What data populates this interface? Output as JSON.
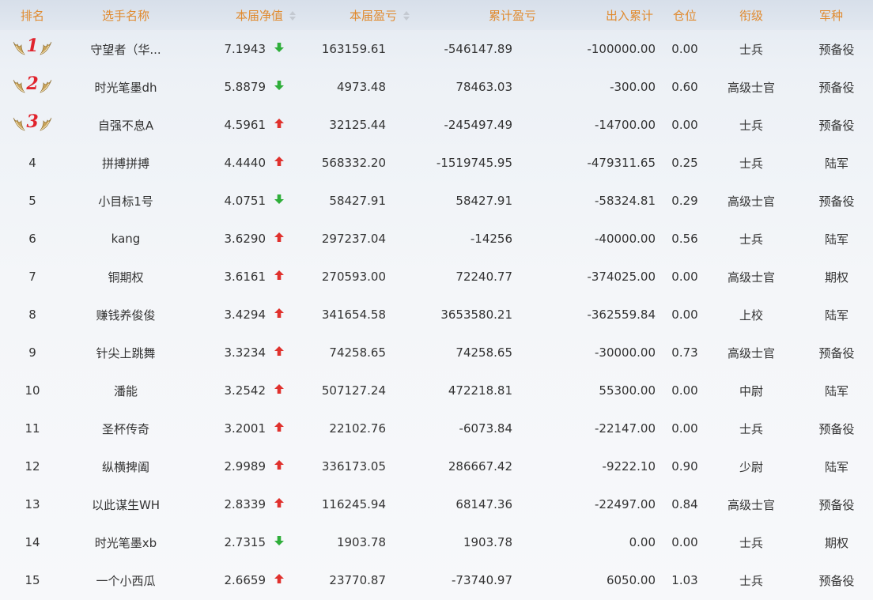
{
  "columns": {
    "rank": "排名",
    "name": "选手名称",
    "nav": "本届净值",
    "pnl": "本届盈亏",
    "cum_pnl": "累计盈亏",
    "flow": "出入累计",
    "position": "仓位",
    "title": "衔级",
    "branch": "军种"
  },
  "colors": {
    "header_text": "#e08a2e",
    "up_arrow": "#e0312d",
    "down_arrow": "#2fae3a",
    "rank_number": "#e0232d",
    "wing_gold": "#c7a25a"
  },
  "rows": [
    {
      "rank": "1",
      "name": "守望者（华...",
      "nav": "7.1943",
      "trend": "down",
      "pnl": "163159.61",
      "cum_pnl": "-546147.89",
      "flow": "-100000.00",
      "position": "0.00",
      "title": "士兵",
      "branch": "预备役"
    },
    {
      "rank": "2",
      "name": "时光笔墨dh",
      "nav": "5.8879",
      "trend": "down",
      "pnl": "4973.48",
      "cum_pnl": "78463.03",
      "flow": "-300.00",
      "position": "0.60",
      "title": "高级士官",
      "branch": "预备役"
    },
    {
      "rank": "3",
      "name": "自强不息A",
      "nav": "4.5961",
      "trend": "up",
      "pnl": "32125.44",
      "cum_pnl": "-245497.49",
      "flow": "-14700.00",
      "position": "0.00",
      "title": "士兵",
      "branch": "预备役"
    },
    {
      "rank": "4",
      "name": "拼搏拼搏",
      "nav": "4.4440",
      "trend": "up",
      "pnl": "568332.20",
      "cum_pnl": "-1519745.95",
      "flow": "-479311.65",
      "position": "0.25",
      "title": "士兵",
      "branch": "陆军"
    },
    {
      "rank": "5",
      "name": "小目标1号",
      "nav": "4.0751",
      "trend": "down",
      "pnl": "58427.91",
      "cum_pnl": "58427.91",
      "flow": "-58324.81",
      "position": "0.29",
      "title": "高级士官",
      "branch": "预备役"
    },
    {
      "rank": "6",
      "name": "kang",
      "nav": "3.6290",
      "trend": "up",
      "pnl": "297237.04",
      "cum_pnl": "-14256",
      "flow": "-40000.00",
      "position": "0.56",
      "title": "士兵",
      "branch": "陆军"
    },
    {
      "rank": "7",
      "name": "铜期权",
      "nav": "3.6161",
      "trend": "up",
      "pnl": "270593.00",
      "cum_pnl": "72240.77",
      "flow": "-374025.00",
      "position": "0.00",
      "title": "高级士官",
      "branch": "期权"
    },
    {
      "rank": "8",
      "name": "赚钱养俊俊",
      "nav": "3.4294",
      "trend": "up",
      "pnl": "341654.58",
      "cum_pnl": "3653580.21",
      "flow": "-362559.84",
      "position": "0.00",
      "title": "上校",
      "branch": "陆军"
    },
    {
      "rank": "9",
      "name": "针尖上跳舞",
      "nav": "3.3234",
      "trend": "up",
      "pnl": "74258.65",
      "cum_pnl": "74258.65",
      "flow": "-30000.00",
      "position": "0.73",
      "title": "高级士官",
      "branch": "预备役"
    },
    {
      "rank": "10",
      "name": "潘能",
      "nav": "3.2542",
      "trend": "up",
      "pnl": "507127.24",
      "cum_pnl": "472218.81",
      "flow": "55300.00",
      "position": "0.00",
      "title": "中尉",
      "branch": "陆军"
    },
    {
      "rank": "11",
      "name": "圣杯传奇",
      "nav": "3.2001",
      "trend": "up",
      "pnl": "22102.76",
      "cum_pnl": "-6073.84",
      "flow": "-22147.00",
      "position": "0.00",
      "title": "士兵",
      "branch": "预备役"
    },
    {
      "rank": "12",
      "name": "纵横捭阖",
      "nav": "2.9989",
      "trend": "up",
      "pnl": "336173.05",
      "cum_pnl": "286667.42",
      "flow": "-9222.10",
      "position": "0.90",
      "title": "少尉",
      "branch": "陆军"
    },
    {
      "rank": "13",
      "name": "以此谋生WH",
      "nav": "2.8339",
      "trend": "up",
      "pnl": "116245.94",
      "cum_pnl": "68147.36",
      "flow": "-22497.00",
      "position": "0.84",
      "title": "高级士官",
      "branch": "预备役"
    },
    {
      "rank": "14",
      "name": "时光笔墨xb",
      "nav": "2.7315",
      "trend": "down",
      "pnl": "1903.78",
      "cum_pnl": "1903.78",
      "flow": "0.00",
      "position": "0.00",
      "title": "士兵",
      "branch": "期权"
    },
    {
      "rank": "15",
      "name": "一个小西瓜",
      "nav": "2.6659",
      "trend": "up",
      "pnl": "23770.87",
      "cum_pnl": "-73740.97",
      "flow": "6050.00",
      "position": "1.03",
      "title": "士兵",
      "branch": "预备役"
    }
  ]
}
